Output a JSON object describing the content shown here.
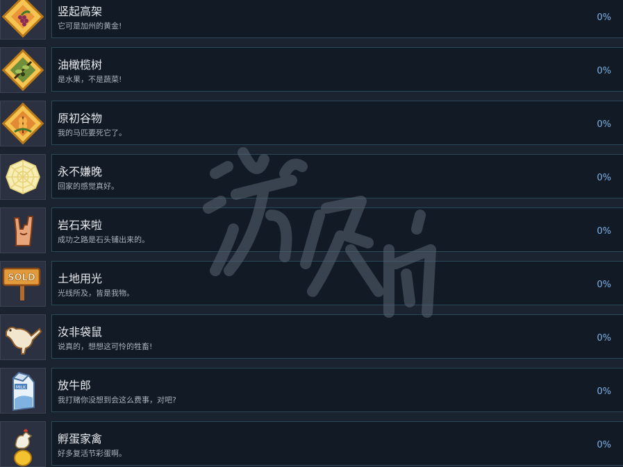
{
  "achievements": [
    {
      "title": "竖起高架",
      "desc": "它可是加州的黄金!",
      "percent": "0%",
      "icon": "grapes-icon"
    },
    {
      "title": "油橄榄树",
      "desc": "是水果，不是蔬菜!",
      "percent": "0%",
      "icon": "olive-branch-icon"
    },
    {
      "title": "原初谷物",
      "desc": "我的马匹要死它了。",
      "percent": "0%",
      "icon": "wheat-icon"
    },
    {
      "title": "永不嫌晚",
      "desc": "回家的感觉真好。",
      "percent": "0%",
      "icon": "spider-web-icon"
    },
    {
      "title": "岩石来啦",
      "desc": "成功之路是石头铺出来的。",
      "percent": "0%",
      "icon": "rock-hand-icon"
    },
    {
      "title": "土地用光",
      "desc": "光线所及，皆是我物。",
      "percent": "0%",
      "icon": "sold-sign-icon"
    },
    {
      "title": "汝非袋鼠",
      "desc": "说真的，想想这可怜的牲畜!",
      "percent": "0%",
      "icon": "kangaroo-icon"
    },
    {
      "title": "放牛郎",
      "desc": "我打赌你没想到会这么费事，对吧?",
      "percent": "0%",
      "icon": "milk-carton-icon"
    },
    {
      "title": "孵蛋家禽",
      "desc": "好多复活节彩蛋啊。",
      "percent": "0%",
      "icon": "chicken-egg-icon"
    }
  ],
  "watermark_text": "游侠网"
}
